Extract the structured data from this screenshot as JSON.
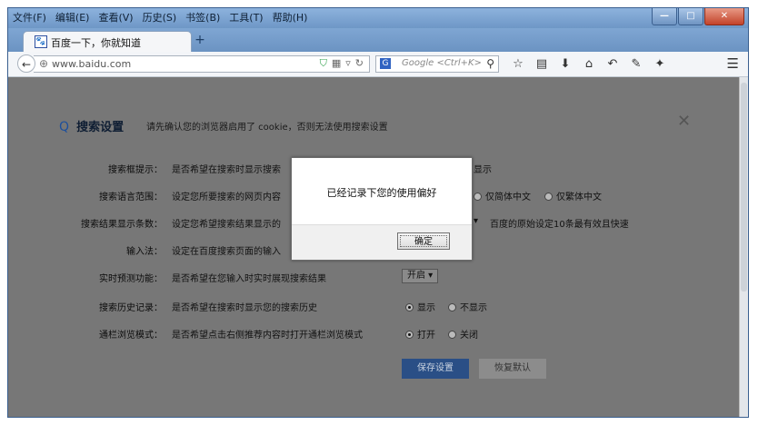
{
  "menu": [
    "文件(F)",
    "编辑(E)",
    "查看(V)",
    "历史(S)",
    "书签(B)",
    "工具(T)",
    "帮助(H)"
  ],
  "window_controls": {
    "minimize": "—",
    "maximize": "□",
    "close": "✕"
  },
  "tab": {
    "title": "百度一下，你就知道"
  },
  "newtab_symbol": "+",
  "address": {
    "url": "www.baidu.com"
  },
  "search": {
    "placeholder": "Google <Ctrl+K>"
  },
  "settings": {
    "title": "搜索设置",
    "note": "请先确认您的浏览器启用了 cookie，否则无法使用搜索设置",
    "rows": [
      {
        "label": "搜索框提示：",
        "desc": "是否希望在搜索时显示搜索",
        "extra": "显示"
      },
      {
        "label": "搜索语言范围：",
        "desc": "设定您所要搜索的网页内容",
        "opt1": "仅简体中文",
        "opt2": "仅繁体中文"
      },
      {
        "label": "搜索结果显示条数：",
        "desc": "设定您希望搜索结果显示的",
        "note": "百度的原始设定10条最有效且快速"
      },
      {
        "label": "输入法：",
        "desc": "设定在百度搜索页面的输入"
      },
      {
        "label": "实时预测功能：",
        "desc": "是否希望在您输入时实时展现搜索结果",
        "select": "开启"
      },
      {
        "label": "搜索历史记录：",
        "desc": "是否希望在搜索时显示您的搜索历史",
        "opt1": "显示",
        "opt2": "不显示"
      },
      {
        "label": "通栏浏览模式：",
        "desc": "是否希望点击右侧推荐内容时打开通栏浏览模式",
        "opt1": "打开",
        "opt2": "关闭"
      }
    ],
    "save_label": "保存设置",
    "restore_label": "恢复默认"
  },
  "dialog": {
    "message": "已经记录下您的使用偏好",
    "ok_label": "确定"
  }
}
